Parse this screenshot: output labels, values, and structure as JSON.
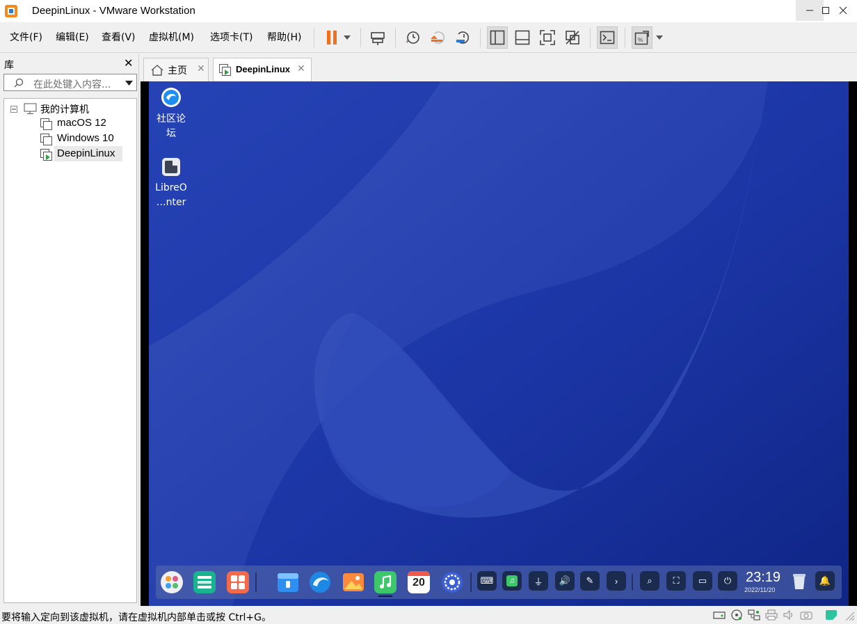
{
  "window": {
    "title": "DeepinLinux - VMware Workstation"
  },
  "menu": [
    "文件(F)",
    "编辑(E)",
    "查看(V)",
    "虚拟机(M)",
    "选项卡(T)",
    "帮助(H)"
  ],
  "library": {
    "title": "库",
    "search_placeholder": "在此处键入内容...",
    "tree": {
      "root": "我的计算机",
      "items": [
        "macOS 12",
        "Windows 10",
        "DeepinLinux"
      ],
      "selected": "DeepinLinux"
    }
  },
  "tabs": [
    {
      "label": "主页",
      "active": false
    },
    {
      "label": "DeepinLinux",
      "active": true
    }
  ],
  "desktop": {
    "icons": [
      {
        "label_line1": "社区论",
        "label_line2": "坛",
        "icon": "deepin-forum-icon"
      },
      {
        "label_line1": "LibreO",
        "label_line2": "…nter",
        "icon": "libreoffice-icon"
      }
    ]
  },
  "dock": {
    "apps": [
      "launcher-icon",
      "multitasking-icon",
      "app-store-grid-icon",
      "file-manager-icon",
      "browser-icon",
      "image-viewer-icon",
      "music-icon",
      "calendar-icon",
      "control-center-icon"
    ],
    "calendar_day": "20",
    "tray": [
      "keyboard-icon",
      "music-tray-icon",
      "usb-icon",
      "volume-icon",
      "pen-icon",
      "expand-icon",
      "search-icon",
      "screenshot-icon",
      "onscreen-keyboard-icon",
      "power-icon"
    ],
    "clock_time": "23:19",
    "clock_date": "2022/11/20"
  },
  "statusbar": {
    "text": "要将输入定向到该虚拟机，请在虚拟机内部单击或按 Ctrl+G。"
  },
  "colors": {
    "pause_orange": "#f0701f",
    "desktop_blue": "#1b35a5",
    "accent_green": "#2ea043"
  }
}
